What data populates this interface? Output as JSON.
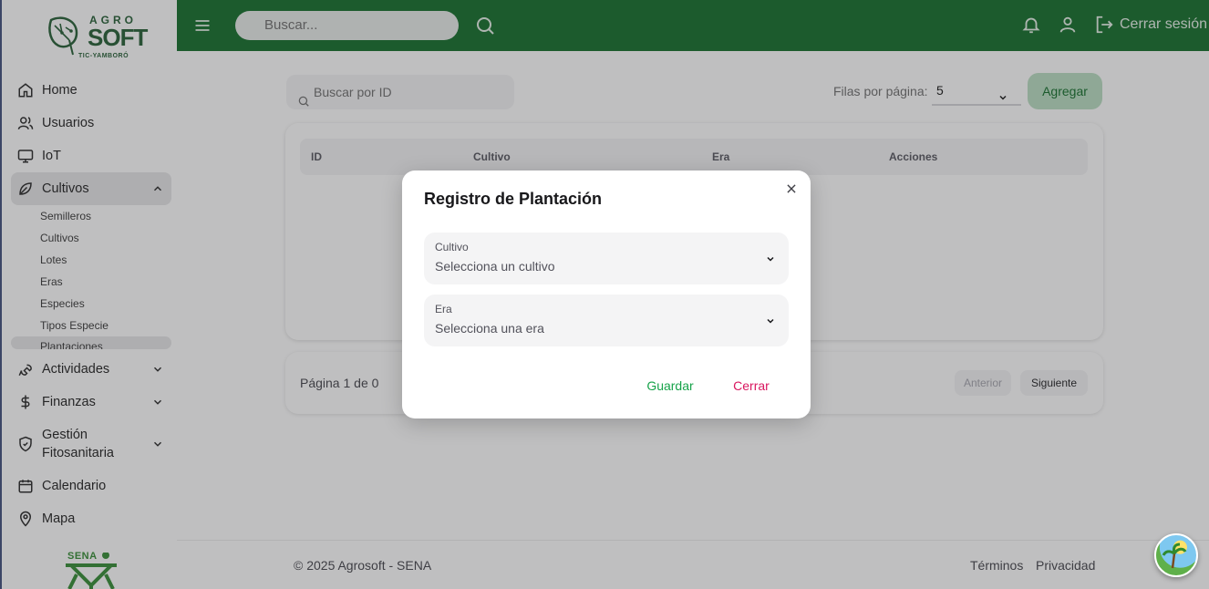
{
  "brand": {
    "logo_top": "AGRO",
    "logo_main": "SOFT",
    "logo_sub": "TIC-YAMBORÓ",
    "footer_logo": "SENA",
    "primary_color": "#0c6b25"
  },
  "sidebar": {
    "items": [
      {
        "label": "Home",
        "icon": "home-icon"
      },
      {
        "label": "Usuarios",
        "icon": "users-icon"
      },
      {
        "label": "IoT",
        "icon": "monitor-icon"
      },
      {
        "label": "Cultivos",
        "icon": "leaf-icon",
        "expanded": true
      },
      {
        "label": "Actividades",
        "icon": "wrench-icon"
      },
      {
        "label": "Finanzas",
        "icon": "dollar-icon"
      },
      {
        "label": "Gestión Fitosanitaria",
        "icon": "shield-icon"
      },
      {
        "label": "Calendario",
        "icon": "calendar-icon"
      },
      {
        "label": "Mapa",
        "icon": "map-pin-icon"
      }
    ],
    "cultivos_sub": [
      "Semilleros",
      "Cultivos",
      "Lotes",
      "Eras",
      "Especies",
      "Tipos Especie",
      "Plantaciones"
    ],
    "gestion_line1": "Gestión",
    "gestion_line2": "Fitosanitaria"
  },
  "topbar": {
    "search_placeholder": "Buscar...",
    "logout_label": "Cerrar sesión"
  },
  "toolbar": {
    "id_search_placeholder": "Buscar por ID",
    "rows_label": "Filas por página:",
    "rows_value": "5",
    "add_label": "Agregar"
  },
  "table": {
    "columns": [
      "ID",
      "Cultivo",
      "Era",
      "Acciones"
    ]
  },
  "pager": {
    "info": "Página 1 de 0",
    "prev_label": "Anterior",
    "next_label": "Siguiente"
  },
  "footer": {
    "copyright": "© 2025 Agrosoft - SENA",
    "terms": "Términos",
    "privacy": "Privacidad"
  },
  "modal": {
    "title": "Registro de Plantación",
    "fields": [
      {
        "label": "Cultivo",
        "value": "Selecciona un cultivo"
      },
      {
        "label": "Era",
        "value": "Selecciona una era"
      }
    ],
    "save_label": "Guardar",
    "close_label": "Cerrar"
  }
}
